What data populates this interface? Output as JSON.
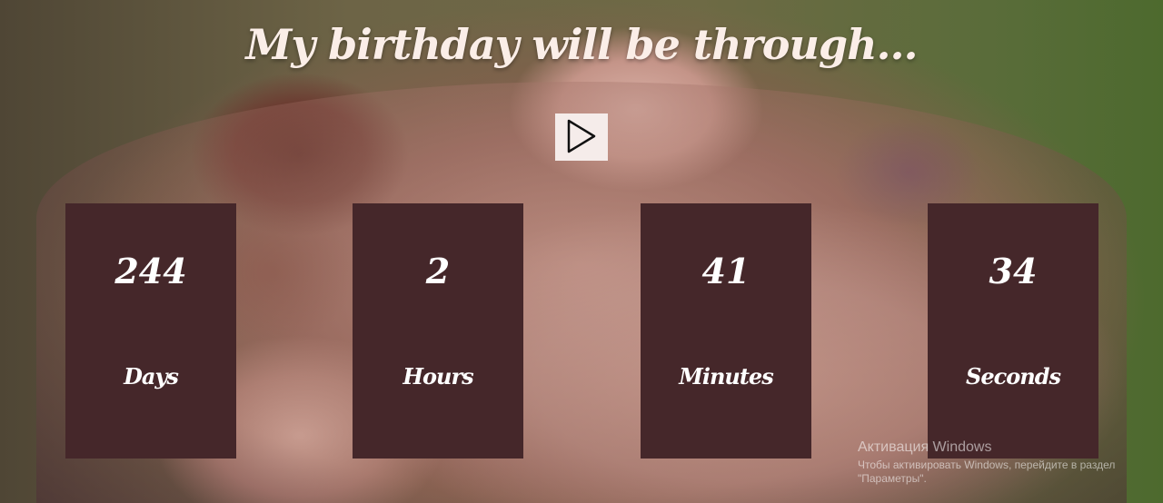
{
  "title": "My birthday will be through...",
  "play_button": {
    "icon": "play-icon"
  },
  "countdown": [
    {
      "value": "244",
      "unit": "Days"
    },
    {
      "value": "2",
      "unit": "Hours"
    },
    {
      "value": "41",
      "unit": "Minutes"
    },
    {
      "value": "34",
      "unit": "Seconds"
    }
  ],
  "colors": {
    "card_background": "#45272a",
    "title_text": "#fbeee8",
    "play_button_background": "#f5ecea"
  },
  "watermark": {
    "title": "Активация Windows",
    "text": "Чтобы активировать Windows, перейдите в раздел \"Параметры\"."
  }
}
